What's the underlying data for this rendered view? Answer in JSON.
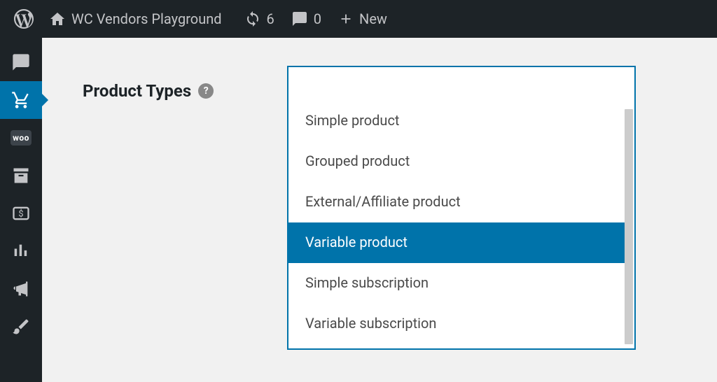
{
  "adminBar": {
    "siteName": "WC Vendors Playground",
    "updateCount": "6",
    "commentCount": "0",
    "newLabel": "New"
  },
  "setting": {
    "label": "Product Types",
    "helpGlyph": "?"
  },
  "productTypes": {
    "options": [
      {
        "label": "Simple product",
        "selected": false
      },
      {
        "label": "Grouped product",
        "selected": false
      },
      {
        "label": "External/Affiliate product",
        "selected": false
      },
      {
        "label": "Variable product",
        "selected": true
      },
      {
        "label": "Simple subscription",
        "selected": false
      },
      {
        "label": "Variable subscription",
        "selected": false
      }
    ]
  },
  "sidebar": {
    "woo_badge": "woo"
  }
}
